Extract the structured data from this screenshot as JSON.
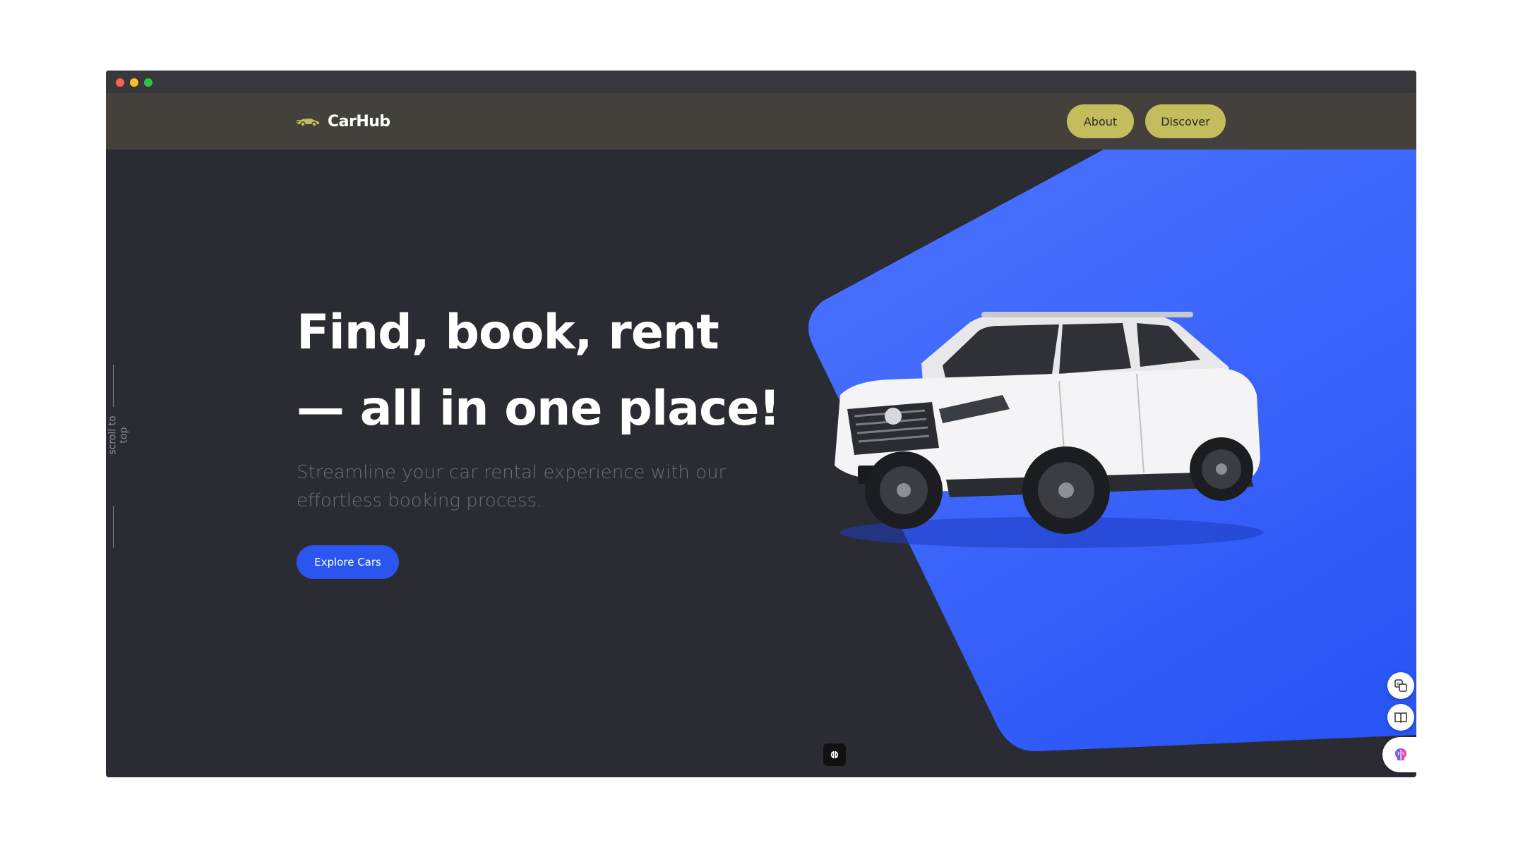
{
  "brand": {
    "name": "CarHub",
    "icon": "car-logo-icon"
  },
  "nav": {
    "about_label": "About",
    "discover_label": "Discover"
  },
  "hero": {
    "headline_line1": "Find, book, rent",
    "headline_line2": "— all in one place!",
    "subtitle": "Streamline your car rental experience with our effortless booking process.",
    "cta_label": "Explore Cars"
  },
  "scroll_to_top": {
    "label": "scroll to top"
  },
  "colors": {
    "background": "#2b2b33",
    "navbar": "#44403b",
    "nav_button": "#c3bd5e",
    "accent_blue": "#2b55ef",
    "hero_shape_light": "#4a72ff",
    "hero_shape_dark": "#2a55f5"
  },
  "icons": {
    "translate": "translate-icon",
    "reader": "book-icon",
    "ai": "brain-icon",
    "bottom": "brain-icon"
  }
}
